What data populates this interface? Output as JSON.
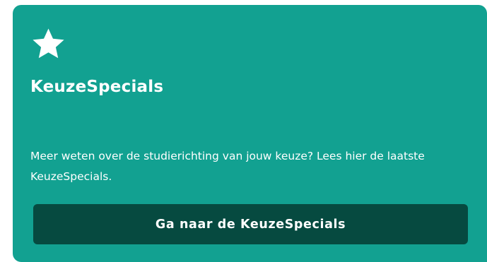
{
  "colors": {
    "card_background": "#12a191",
    "button_background": "#064a40",
    "text": "#ffffff"
  },
  "card": {
    "icon": "star-icon",
    "title": "KeuzeSpecials",
    "description": "Meer weten over de studierichting van jouw keuze? Lees hier de laatste KeuzeSpecials.",
    "button_label": "Ga naar de KeuzeSpecials"
  }
}
